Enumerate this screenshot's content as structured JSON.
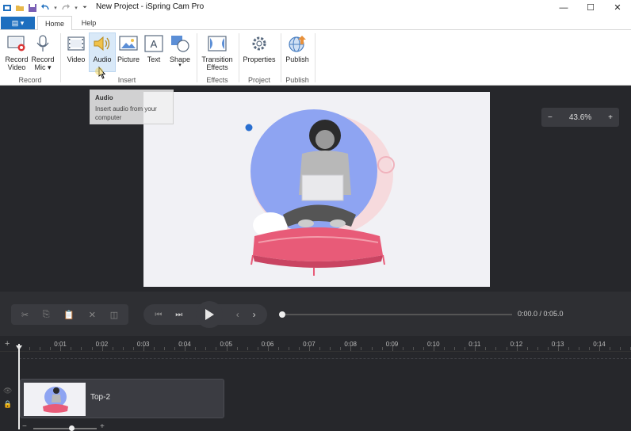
{
  "window": {
    "title": "New Project - iSpring Cam Pro",
    "minimize": "—",
    "maximize": "☐",
    "close": "✕"
  },
  "tabs": {
    "file": "▤ ▾",
    "home": "Home",
    "help": "Help"
  },
  "ribbon": {
    "record_video_l1": "Record",
    "record_video_l2": "Video",
    "record_mic_l1": "Record",
    "record_mic_l2": "Mic ▾",
    "video": "Video",
    "audio": "Audio",
    "picture": "Picture",
    "text": "Text",
    "shape": "Shape",
    "shape_arrow": "▾",
    "transition_l1": "Transition",
    "transition_l2": "Effects",
    "properties": "Properties",
    "publish": "Publish",
    "groups": {
      "record": "Record",
      "insert": "Insert",
      "effects": "Effects",
      "project": "Project",
      "publish": "Publish"
    }
  },
  "tooltip": {
    "title": "Audio",
    "body": "Insert audio from your computer"
  },
  "zoom": {
    "minus": "−",
    "value": "43.6%",
    "plus": "+"
  },
  "player": {
    "time": "0:00.0 / 0:05.0",
    "progress": 0
  },
  "timeline": {
    "add": "+",
    "ticks": [
      "0:01",
      "0:02",
      "0:03",
      "0:04",
      "0:05",
      "0:06",
      "0:07",
      "0:08",
      "0:09",
      "0:10",
      "0:11",
      "0:12",
      "0:13",
      "0:14"
    ],
    "clip_label": "Top-2",
    "zoom_minus": "−",
    "zoom_plus": "+",
    "zoom_level": 0.6
  },
  "colors": {
    "accent": "#1e6fbf",
    "stage_bg": "#26272b",
    "slide_bg": "#f1f1f5",
    "blob_blue": "#8ea4f2",
    "cushion_pink": "#e85b78"
  }
}
